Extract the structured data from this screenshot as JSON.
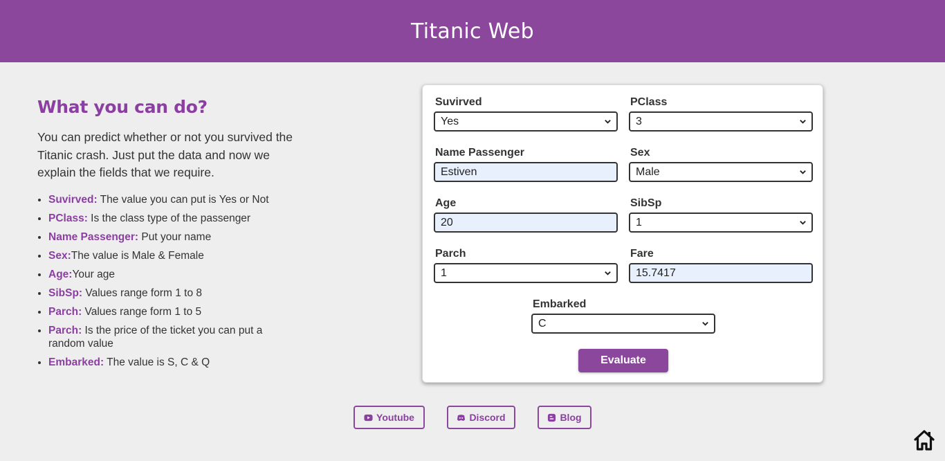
{
  "header": {
    "title": "Titanic Web"
  },
  "info": {
    "heading": "What you can do?",
    "paragraph": "You can predict whether or not you survived the Titanic crash. Just put the data and now we explain the fields that we require.",
    "items": [
      {
        "term": "Suvirved:",
        "desc": " The value you can put is Yes or Not"
      },
      {
        "term": "PClass:",
        "desc": " Is the class type of the passenger"
      },
      {
        "term": "Name Passenger:",
        "desc": " Put your name"
      },
      {
        "term": "Sex:",
        "desc": "The value is Male & Female"
      },
      {
        "term": "Age:",
        "desc": "Your age"
      },
      {
        "term": "SibSp:",
        "desc": " Values range form 1 to 8"
      },
      {
        "term": "Parch:",
        "desc": " Values range form 1 to 5"
      },
      {
        "term": "Parch:",
        "desc": " Is the price of the ticket you can put a random value"
      },
      {
        "term": "Embarked:",
        "desc": " The value is S, C & Q"
      }
    ]
  },
  "form": {
    "survived": {
      "label": "Suvirved",
      "value": "Yes"
    },
    "pclass": {
      "label": "PClass",
      "value": "3"
    },
    "name": {
      "label": "Name Passenger",
      "value": "Estiven"
    },
    "sex": {
      "label": "Sex",
      "value": "Male"
    },
    "age": {
      "label": "Age",
      "value": "20"
    },
    "sibsp": {
      "label": "SibSp",
      "value": "1"
    },
    "parch": {
      "label": "Parch",
      "value": "1"
    },
    "fare": {
      "label": "Fare",
      "value": "15.7417"
    },
    "embarked": {
      "label": "Embarked",
      "value": "C"
    },
    "submit_label": "Evaluate"
  },
  "links": {
    "youtube": "Youtube",
    "discord": "Discord",
    "blog": "Blog"
  },
  "colors": {
    "accent": "#8b479b",
    "background": "#eeeeee",
    "input_fill": "#e8f0fe"
  },
  "icons": [
    "youtube-icon",
    "discord-icon",
    "blogger-icon",
    "home-icon",
    "chevron-down-icon"
  ]
}
